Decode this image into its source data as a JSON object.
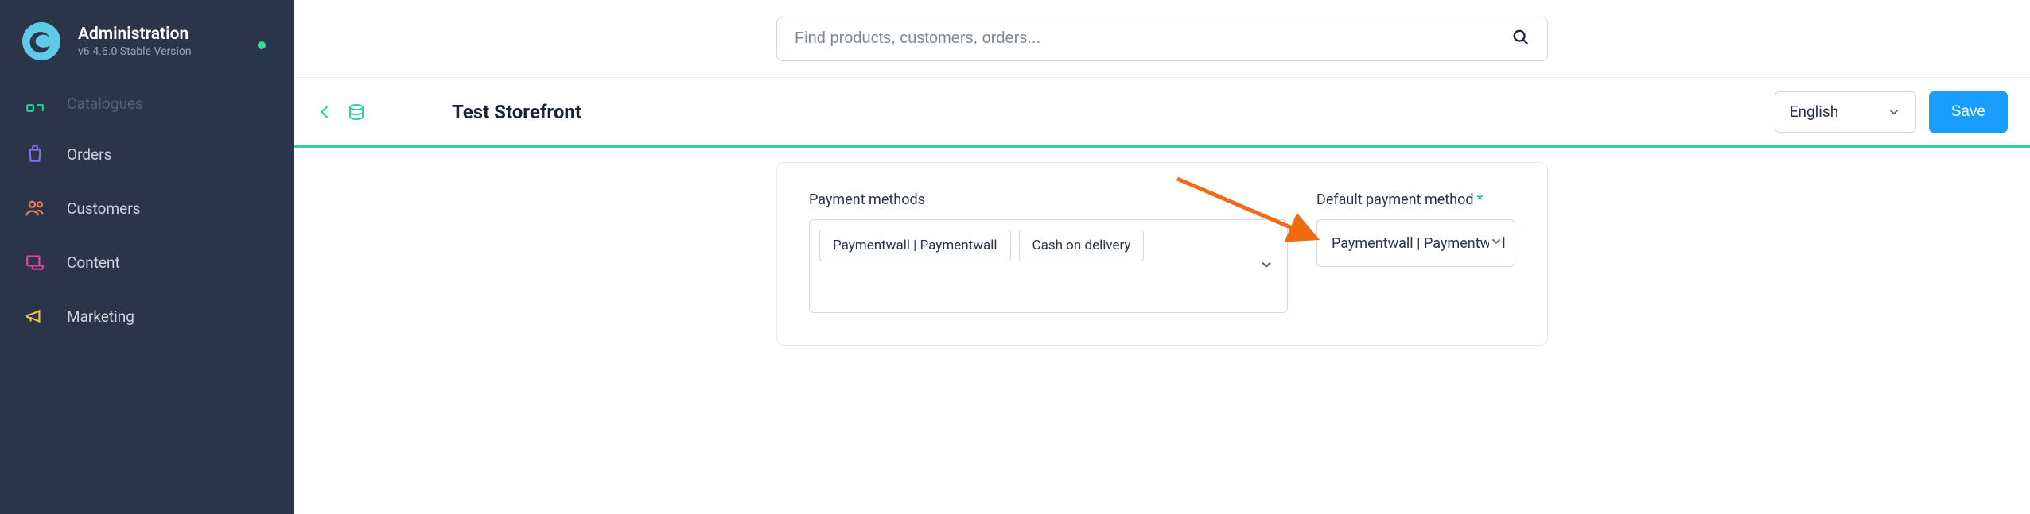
{
  "brand": {
    "title": "Administration",
    "version": "v6.4.6.0 Stable Version"
  },
  "sidebar": {
    "items": [
      {
        "label": "Catalogues"
      },
      {
        "label": "Orders"
      },
      {
        "label": "Customers"
      },
      {
        "label": "Content"
      },
      {
        "label": "Marketing"
      }
    ]
  },
  "search": {
    "placeholder": "Find products, customers, orders..."
  },
  "toolbar": {
    "page_title": "Test Storefront",
    "language": "English",
    "save_label": "Save"
  },
  "form": {
    "payment_methods_label": "Payment methods",
    "payment_methods": [
      "Paymentwall | Paymentwall",
      "Cash on delivery"
    ],
    "default_payment_label": "Default payment method",
    "default_payment_value": "Paymentwall | Paymentwall"
  },
  "colors": {
    "accent": "#189eff",
    "sidebar_bg": "#2a3549",
    "teal_underline": "#2ed3a4",
    "arrow": "#f06a14",
    "status_dot": "#3dd598"
  }
}
